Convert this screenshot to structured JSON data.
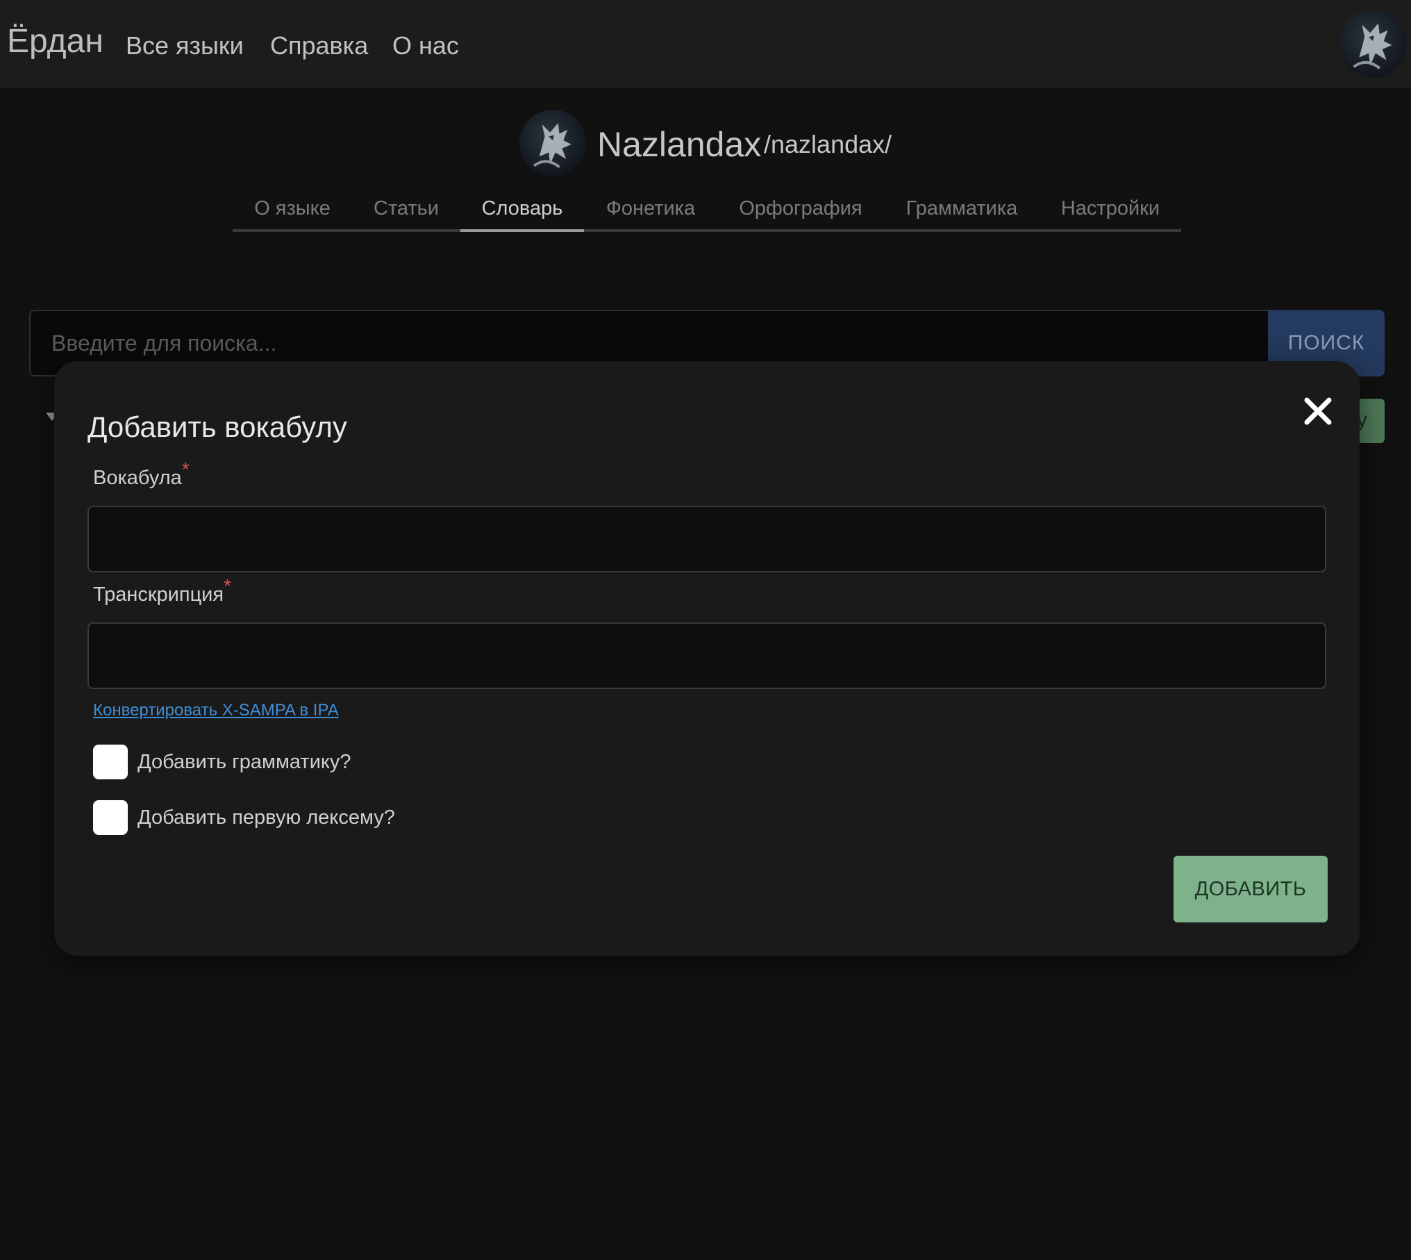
{
  "nav": {
    "brand": "Ёрдан",
    "links": [
      "Все языки",
      "Справка",
      "О нас"
    ],
    "user_avatar_icon": "wolf-avatar-icon"
  },
  "language": {
    "name": "Nazlandax",
    "ipa": "/nazlandax/",
    "avatar_icon": "wolf-avatar-icon"
  },
  "tabs": [
    {
      "label": "О языке",
      "active": false
    },
    {
      "label": "Статьи",
      "active": false
    },
    {
      "label": "Словарь",
      "active": true
    },
    {
      "label": "Фонетика",
      "active": false
    },
    {
      "label": "Орфография",
      "active": false
    },
    {
      "label": "Грамматика",
      "active": false
    },
    {
      "label": "Настройки",
      "active": false
    }
  ],
  "search": {
    "placeholder": "Введите для поиска...",
    "value": "",
    "button_label": "ПОИСК"
  },
  "background": {
    "add_button_partial": "у"
  },
  "modal": {
    "title": "Добавить вокабулу",
    "close_icon": "close-icon",
    "fields": [
      {
        "label": "Вокабула",
        "required_mark": "*",
        "value": ""
      },
      {
        "label": "Транскрипция",
        "required_mark": "*",
        "value": ""
      }
    ],
    "convert_link": "Конвертировать X-SAMPA в IPA",
    "checkboxes": [
      {
        "label": "Добавить грамматику?",
        "checked": false
      },
      {
        "label": "Добавить первую лексему?",
        "checked": false
      }
    ],
    "submit_label": "ДОБАВИТЬ"
  },
  "colors": {
    "page_bg": "#111111",
    "nav_bg": "#1c1c1c",
    "modal_bg": "#1a1a1a",
    "search_button_bg": "#243a5e",
    "submit_bg": "#7db28b",
    "link": "#3f8fd6",
    "required": "#d9534f"
  }
}
